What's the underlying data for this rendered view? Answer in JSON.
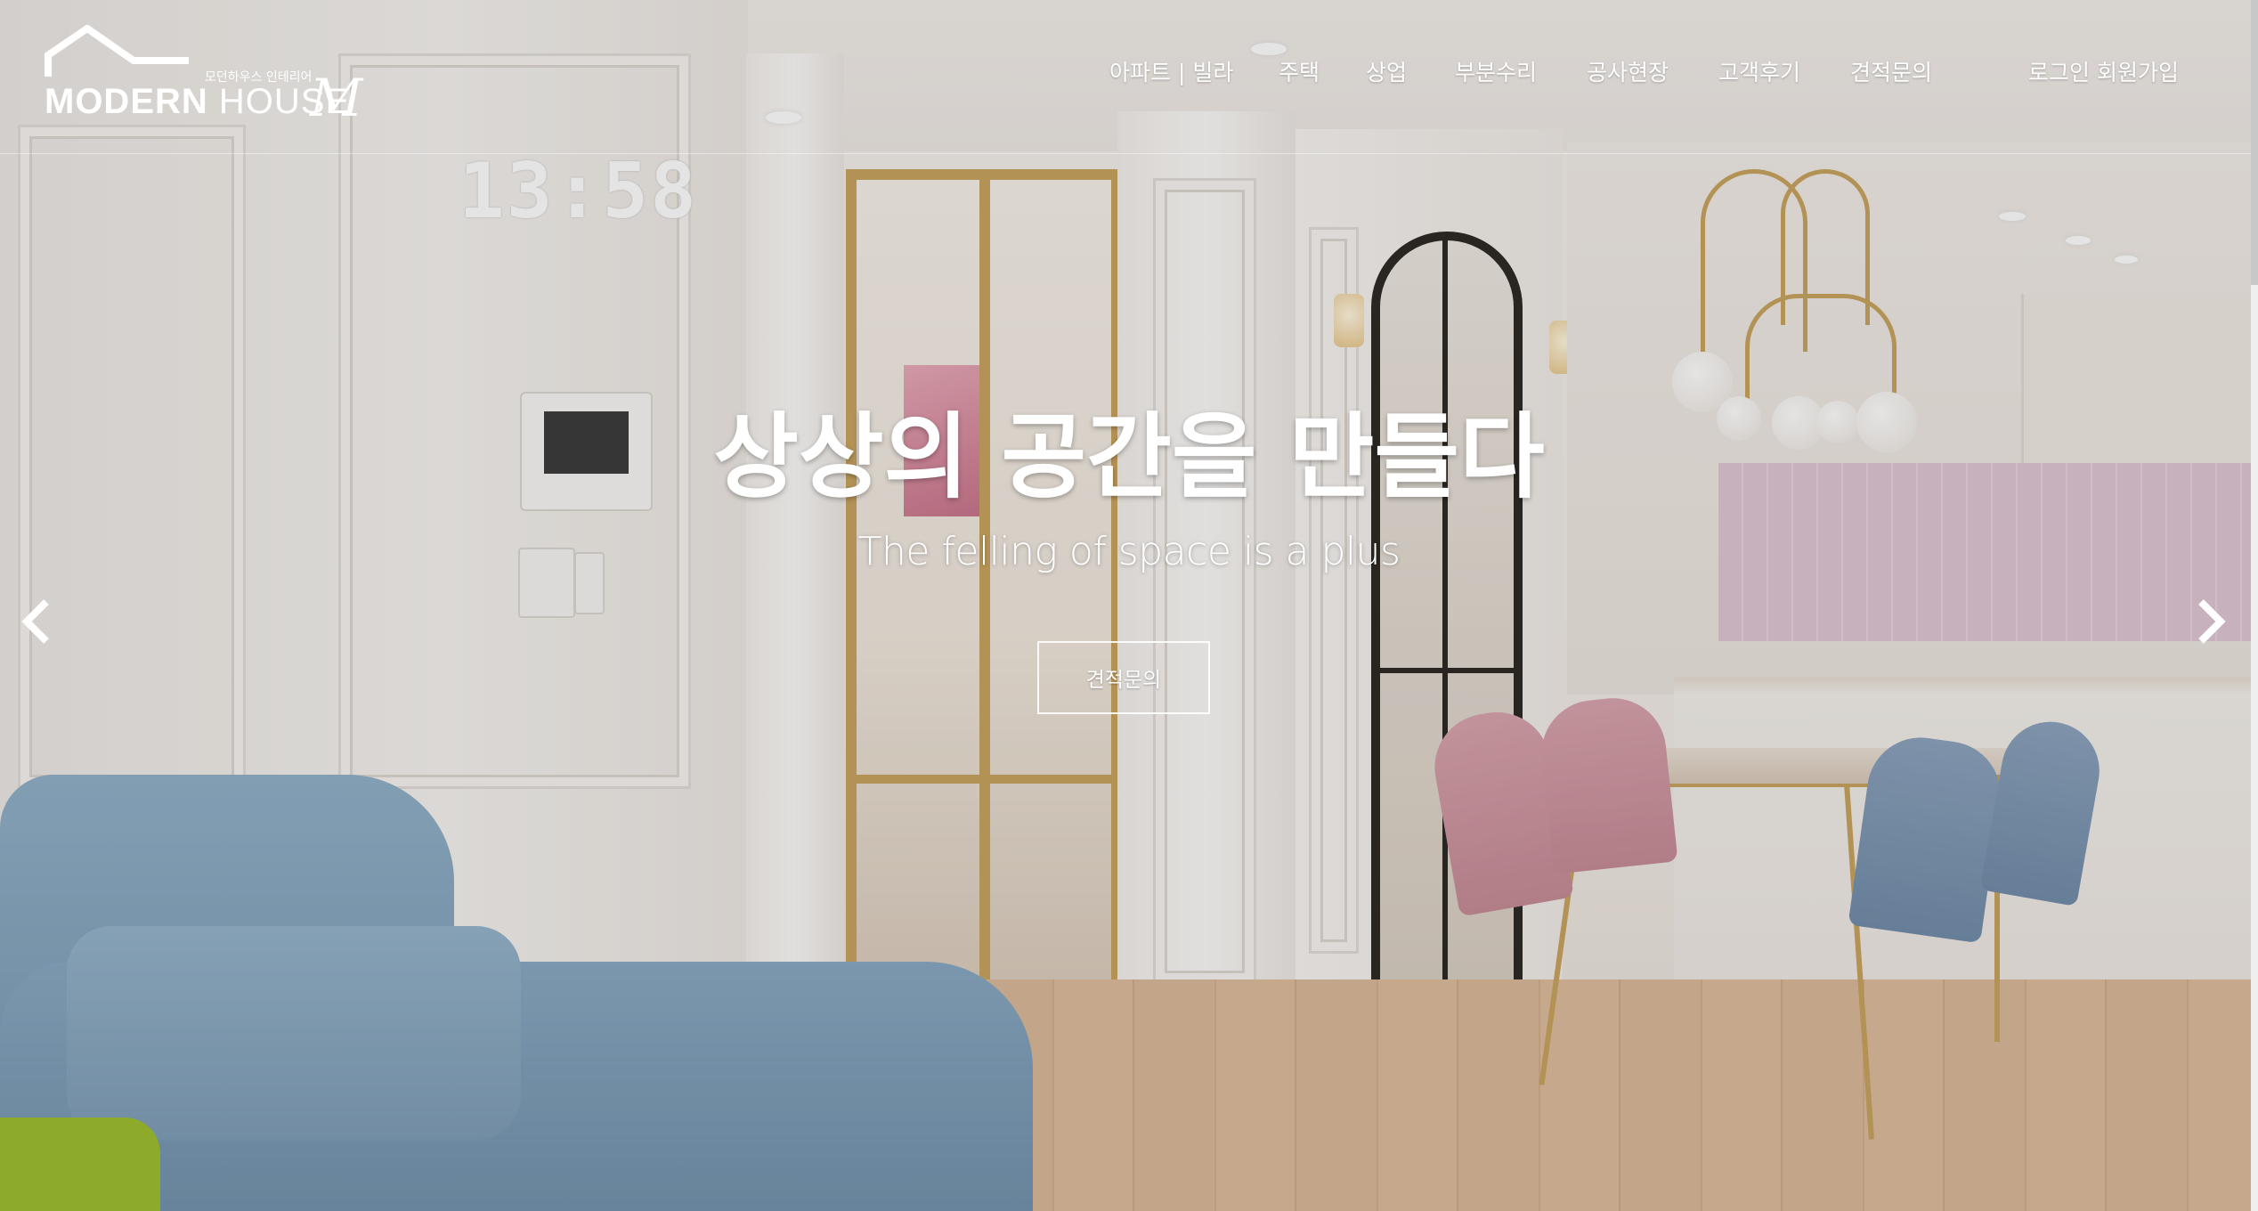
{
  "brand": {
    "primary": "MODERN",
    "secondary": "HOUSE",
    "script_letter": "M",
    "tagline": "모던하우스 인테리어"
  },
  "nav": {
    "items": [
      "아파트 | 빌라",
      "주택",
      "상업",
      "부분수리",
      "공사현장",
      "고객후기",
      "견적문의"
    ],
    "auth": "로그인 회원가입"
  },
  "hero": {
    "title": "상상의 공간을 만들다",
    "subtitle": "The felling of space is a plus",
    "cta_label": "견적문의",
    "clock": "13:58"
  },
  "carousel": {
    "prev_icon": "chevron-left-icon",
    "next_icon": "chevron-right-icon"
  },
  "colors": {
    "text": "#ffffff",
    "accent_gold": "#c7a25d"
  }
}
